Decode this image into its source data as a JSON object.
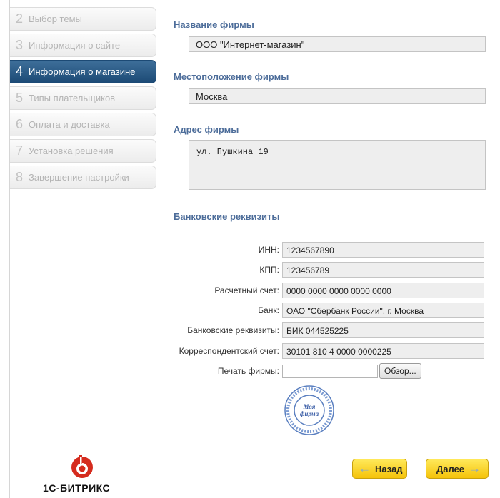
{
  "steps": [
    {
      "num": "2",
      "label": "Выбор темы",
      "active": false
    },
    {
      "num": "3",
      "label": "Информация о сайте",
      "active": false
    },
    {
      "num": "4",
      "label": "Информация о магазине",
      "active": true
    },
    {
      "num": "5",
      "label": "Типы плательщиков",
      "active": false
    },
    {
      "num": "6",
      "label": "Оплата и доставка",
      "active": false
    },
    {
      "num": "7",
      "label": "Установка решения",
      "active": false
    },
    {
      "num": "8",
      "label": "Завершение настройки",
      "active": false
    }
  ],
  "form": {
    "company_name_heading": "Название фирмы",
    "company_name_value": "ООО \"Интернет-магазин\"",
    "location_heading": "Местоположение фирмы",
    "location_value": "Москва",
    "address_heading": "Адрес фирмы",
    "address_value": "ул. Пушкина 19",
    "bank_heading": "Банковские реквизиты"
  },
  "bank": {
    "inn_label": "ИНН:",
    "inn_value": "1234567890",
    "kpp_label": "КПП:",
    "kpp_value": "123456789",
    "account_label": "Расчетный счет:",
    "account_value": "0000 0000 0000 0000 0000",
    "bank_label": "Банк:",
    "bank_value": "ОАО \"Сбербанк России\", г. Москва",
    "details_label": "Банковские реквизиты:",
    "details_value": "БИК 044525225",
    "corr_label": "Корреспондентский счет:",
    "corr_value": "30101 810 4 0000 0000225",
    "stamp_label": "Печать фирмы:",
    "browse_label": "Обзор..."
  },
  "stamp": {
    "text_line1": "Моя",
    "text_line2": "фирма"
  },
  "logo": {
    "text": "1С-БИТРИКС",
    "color": "#d52b1e"
  },
  "nav": {
    "back_label": "Назад",
    "next_label": "Далее"
  },
  "colors": {
    "accent": "#1c4a75",
    "heading": "#4d6d9a",
    "button": "#f5c30a"
  }
}
